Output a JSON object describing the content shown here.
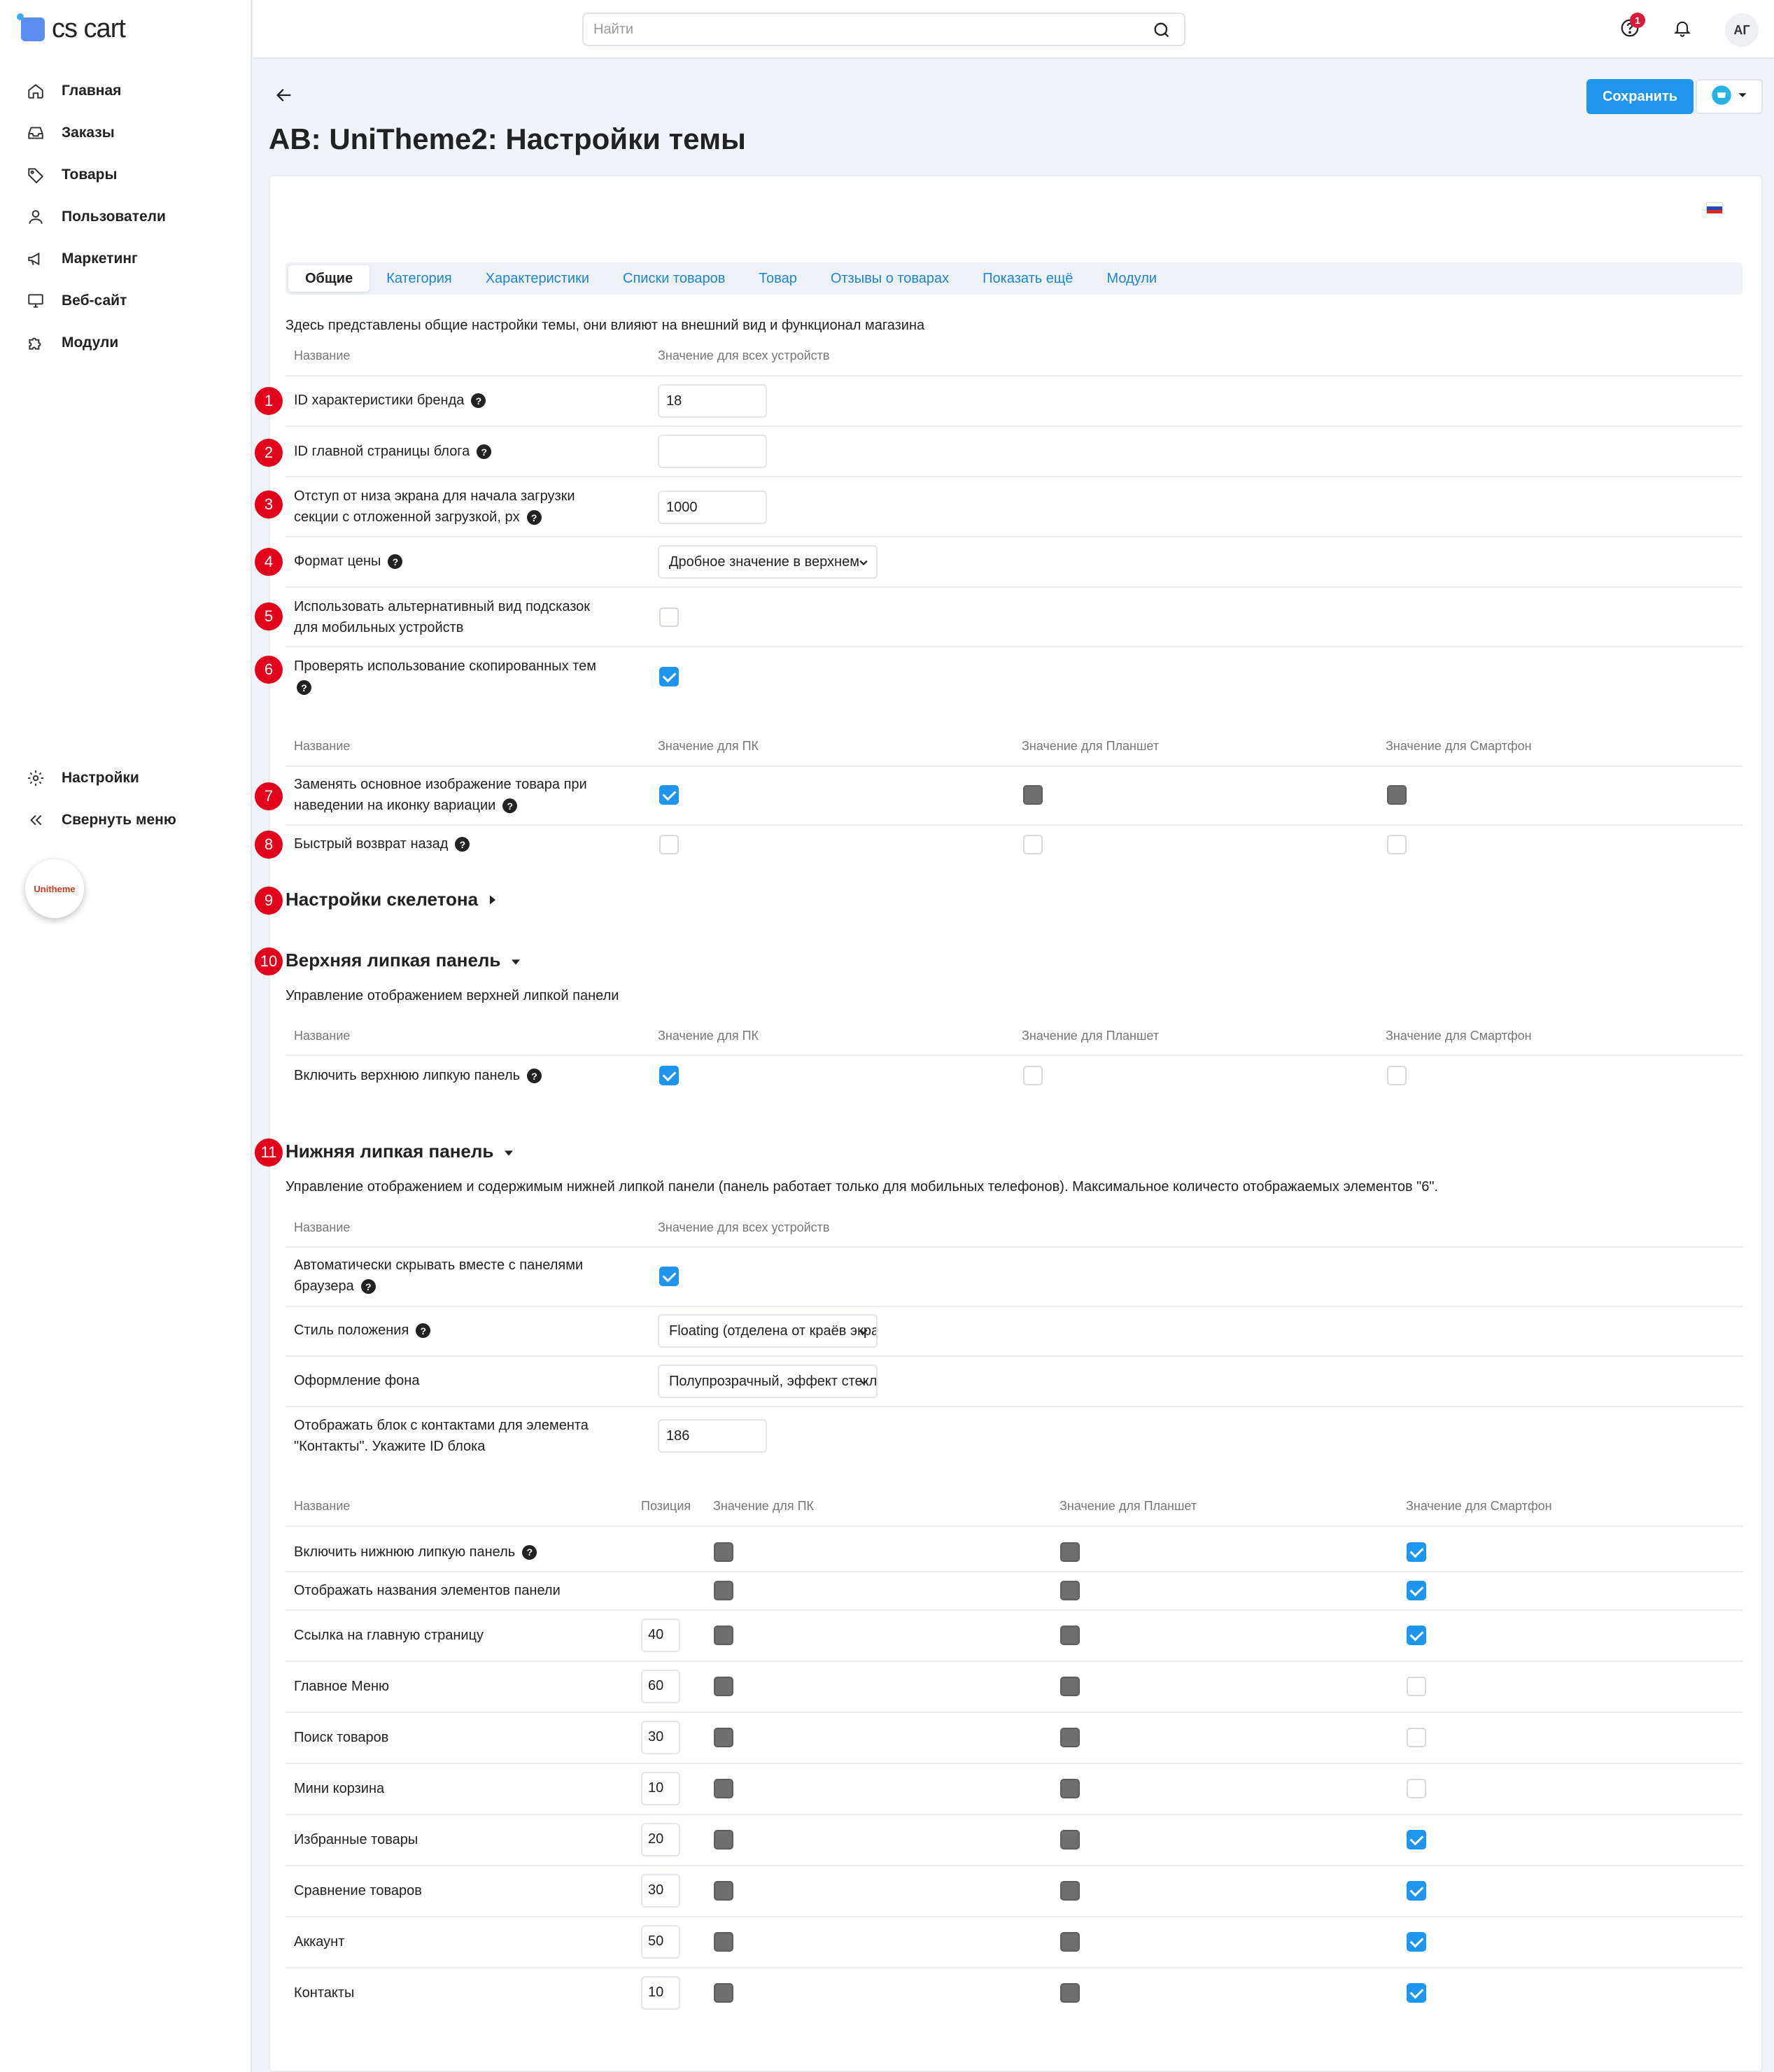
{
  "app": {
    "logo_text": "cs cart"
  },
  "sidebar": {
    "items": [
      {
        "label": "Главная",
        "icon": "home-icon"
      },
      {
        "label": "Заказы",
        "icon": "inbox-icon"
      },
      {
        "label": "Товары",
        "icon": "tag-icon"
      },
      {
        "label": "Пользователи",
        "icon": "user-icon"
      },
      {
        "label": "Маркетинг",
        "icon": "megaphone-icon"
      },
      {
        "label": "Веб-сайт",
        "icon": "monitor-icon"
      },
      {
        "label": "Модули",
        "icon": "puzzle-icon"
      }
    ],
    "bottom": [
      {
        "label": "Настройки",
        "icon": "gear-icon"
      },
      {
        "label": "Свернуть меню",
        "icon": "collapse-icon"
      }
    ],
    "addon_badge": "Unitheme"
  },
  "topbar": {
    "search_placeholder": "Найти",
    "help_badge_count": "1",
    "avatar_initials": "АГ"
  },
  "header": {
    "title": "AB: UniTheme2: Настройки темы",
    "save_label": "Сохранить"
  },
  "tabs": [
    "Общие",
    "Категория",
    "Характеристики",
    "Списки товаров",
    "Товар",
    "Отзывы о товарах",
    "Показать ещё",
    "Модули"
  ],
  "general": {
    "description": "Здесь представлены общие настройки темы, они влияют на внешний вид и функционал магазина",
    "col_name": "Название",
    "col_all": "Значение для всех устройств",
    "col_pc": "Значение для ПК",
    "col_tablet": "Значение для Планшет",
    "col_phone": "Значение для Смартфон",
    "col_position": "Позиция",
    "rows": [
      {
        "num": "1",
        "label": "ID характеристики бренда",
        "value": "18"
      },
      {
        "num": "2",
        "label": "ID главной страницы блога",
        "value": ""
      },
      {
        "num": "3",
        "label_1": "Отступ от низа экрана для начала загрузки",
        "label_2": "секции с отложенной загрузкой, px",
        "value": "1000"
      },
      {
        "num": "4",
        "label": "Формат цены",
        "value": "Дробное значение в верхнем"
      },
      {
        "num": "5",
        "label_1": "Использовать альтернативный вид подсказок",
        "label_2": "для мобильных устройств",
        "checked": false
      },
      {
        "num": "6",
        "label": "Проверять использование скопированных тем",
        "checked": true
      }
    ],
    "device_rows": [
      {
        "num": "7",
        "label_1": "Заменять основное изображение товара при",
        "label_2": "наведении на иконку вариации",
        "pc": "on",
        "tablet": "disabled",
        "phone": "disabled"
      },
      {
        "num": "8",
        "label": "Быстрый возврат назад",
        "pc": "off",
        "tablet": "off",
        "phone": "off"
      }
    ]
  },
  "skeleton": {
    "num": "9",
    "title": "Настройки скелетона"
  },
  "top_sticky": {
    "num": "10",
    "title": "Верхняя липкая панель",
    "description": "Управление отображением верхней липкой панели",
    "row_label": "Включить верхнюю липкую панель",
    "pc": "on",
    "tablet": "off",
    "phone": "off"
  },
  "bottom_sticky": {
    "num": "11",
    "title": "Нижняя липкая панель",
    "description": "Управление отображением и содержимым нижней липкой панели (панель работает только для мобильных телефонов). Максимальное количесто отображаемых элементов \"6\".",
    "auto_hide_1": "Автоматически скрывать вместе с панелями",
    "auto_hide_2": "браузера",
    "position_style_label": "Стиль положения",
    "position_style_value": "Floating (отделена от краёв экрана)",
    "bg_label": "Оформление фона",
    "bg_value": "Полупрозрачный, эффект стекла",
    "contacts_label_1": "Отображать блок с контактами для элемента",
    "contacts_label_2": "\"Контакты\". Укажите ID блока",
    "contacts_value": "186",
    "items": [
      {
        "label": "Включить нижнюю липкую панель",
        "help": true,
        "position": null,
        "pc": "disabled",
        "tablet": "disabled",
        "phone": "on"
      },
      {
        "label": "Отображать названия элементов панели",
        "help": false,
        "position": null,
        "pc": "disabled",
        "tablet": "disabled",
        "phone": "on"
      },
      {
        "label": "Ссылка на главную страницу",
        "help": false,
        "position": "40",
        "pc": "disabled",
        "tablet": "disabled",
        "phone": "on"
      },
      {
        "label": "Главное Меню",
        "help": false,
        "position": "60",
        "pc": "disabled",
        "tablet": "disabled",
        "phone": "off"
      },
      {
        "label": "Поиск товаров",
        "help": false,
        "position": "30",
        "pc": "disabled",
        "tablet": "disabled",
        "phone": "off"
      },
      {
        "label": "Мини корзина",
        "help": false,
        "position": "10",
        "pc": "disabled",
        "tablet": "disabled",
        "phone": "off"
      },
      {
        "label": "Избранные товары",
        "help": false,
        "position": "20",
        "pc": "disabled",
        "tablet": "disabled",
        "phone": "on"
      },
      {
        "label": "Сравнение товаров",
        "help": false,
        "position": "30",
        "pc": "disabled",
        "tablet": "disabled",
        "phone": "on"
      },
      {
        "label": "Аккаунт",
        "help": false,
        "position": "50",
        "pc": "disabled",
        "tablet": "disabled",
        "phone": "on"
      },
      {
        "label": "Контакты",
        "help": false,
        "position": "10",
        "pc": "disabled",
        "tablet": "disabled",
        "phone": "on"
      }
    ]
  },
  "colors": {
    "accent": "#1e96f0",
    "marker": "#e3001b",
    "link": "#1e86d8"
  }
}
